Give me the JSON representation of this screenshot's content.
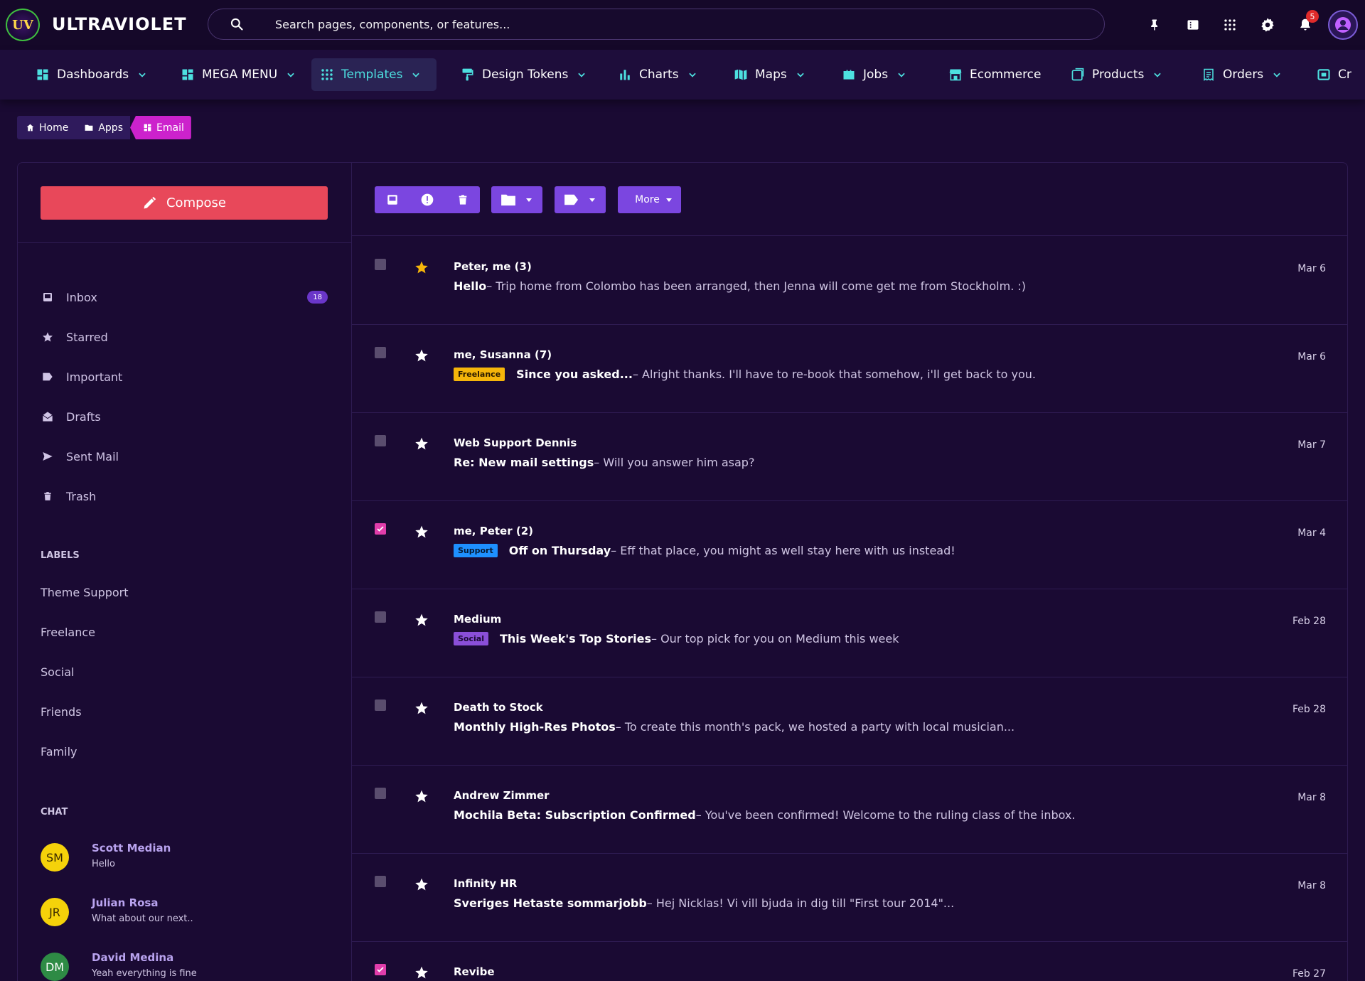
{
  "header": {
    "logo_text": "UV",
    "brand": "ULTRAVIOLET",
    "search_placeholder": "Search pages, components, or features...",
    "notification_count": "5",
    "icons": [
      "search-icon",
      "pin-icon",
      "list-icon",
      "apps-grid-icon",
      "gear-icon",
      "bell-icon",
      "user-icon"
    ]
  },
  "nav": {
    "items": [
      {
        "label": "Dashboards",
        "icon": "dashboard-icon",
        "dropdown": true
      },
      {
        "label": "MEGA MENU",
        "icon": "dashboard-icon",
        "dropdown": true
      },
      {
        "label": "Templates",
        "icon": "grid-dots-icon",
        "dropdown": true,
        "active": true
      },
      {
        "label": "Design Tokens",
        "icon": "paint-roller-icon",
        "dropdown": true
      },
      {
        "label": "Charts",
        "icon": "bar-chart-icon",
        "dropdown": true
      },
      {
        "label": "Maps",
        "icon": "map-icon",
        "dropdown": true
      },
      {
        "label": "Jobs",
        "icon": "briefcase-icon",
        "dropdown": true
      },
      {
        "label": "Ecommerce",
        "icon": "store-icon",
        "dropdown": false
      },
      {
        "label": "Products",
        "icon": "tag-box-icon",
        "dropdown": true
      },
      {
        "label": "Orders",
        "icon": "receipt-icon",
        "dropdown": true
      },
      {
        "label": "Cr",
        "icon": "card-icon",
        "dropdown": false
      }
    ]
  },
  "breadcrumb": [
    {
      "label": "Home",
      "icon": "home-icon"
    },
    {
      "label": "Apps",
      "icon": "folder-icon"
    },
    {
      "label": "Email",
      "icon": "dashboard-icon",
      "current": true
    }
  ],
  "sidebar": {
    "compose_label": "Compose",
    "folders": [
      {
        "label": "Inbox",
        "icon": "inbox-icon",
        "count": "18"
      },
      {
        "label": "Starred",
        "icon": "star-icon"
      },
      {
        "label": "Important",
        "icon": "label-icon"
      },
      {
        "label": "Drafts",
        "icon": "envelope-open-icon"
      },
      {
        "label": "Sent Mail",
        "icon": "send-icon"
      },
      {
        "label": "Trash",
        "icon": "trash-icon"
      }
    ],
    "labels_title": "LABELS",
    "labels": [
      "Theme Support",
      "Freelance",
      "Social",
      "Friends",
      "Family"
    ],
    "chat_title": "CHAT",
    "chats": [
      {
        "initials": "SM",
        "name": "Scott Median",
        "message": "Hello",
        "color": "#f5d20a"
      },
      {
        "initials": "JR",
        "name": "Julian Rosa",
        "message": "What about our next..",
        "color": "#f5d20a"
      },
      {
        "initials": "DM",
        "name": "David Medina",
        "message": "Yeah everything is fine",
        "color": "#2e8b45"
      }
    ]
  },
  "toolbar": {
    "more_label": "More",
    "icons": [
      "inbox-icon",
      "alert-icon",
      "trash-icon",
      "folder-icon",
      "label-icon"
    ]
  },
  "colors": {
    "accent": "#7b46e0",
    "compose": "#e8485a",
    "checked": "#e13dab",
    "star_active": "#f5b50a",
    "tag_freelance": "#f5b50a",
    "tag_support": "#1e90ff",
    "tag_social": "#8a4fd8"
  },
  "emails": [
    {
      "from": "Peter, me (3)",
      "subject": "Hello",
      "snippet": " – Trip home from Colombo has been arranged, then Jenna will come get me from Stockholm. :)",
      "date": "Mar 6",
      "starred": true,
      "checked": false
    },
    {
      "from": "me, Susanna (7)",
      "tag": "Freelance",
      "subject": "Since you asked...",
      "snippet": " – Alright thanks. I'll have to re-book that somehow, i'll get back to you.",
      "date": "Mar 6",
      "starred": false,
      "checked": false
    },
    {
      "from": "Web Support Dennis",
      "subject": "Re: New mail settings",
      "snippet": " – Will you answer him asap?",
      "date": "Mar 7",
      "starred": false,
      "checked": false
    },
    {
      "from": "me, Peter (2)",
      "tag": "Support",
      "subject": "Off on Thursday",
      "snippet": " – Eff that place, you might as well stay here with us instead!",
      "date": "Mar 4",
      "starred": false,
      "checked": true
    },
    {
      "from": "Medium",
      "tag": "Social",
      "subject": "This Week's Top Stories",
      "snippet": " – Our top pick for you on Medium this week",
      "date": "Feb 28",
      "starred": false,
      "checked": false
    },
    {
      "from": "Death to Stock",
      "subject": "Monthly High-Res Photos",
      "snippet": " – To create this month's pack, we hosted a party with local musician...",
      "date": "Feb 28",
      "starred": false,
      "checked": false
    },
    {
      "from": "Andrew Zimmer",
      "subject": "Mochila Beta: Subscription Confirmed",
      "snippet": " – You've been confirmed! Welcome to the ruling class of the inbox.",
      "date": "Mar 8",
      "starred": false,
      "checked": false
    },
    {
      "from": "Infinity HR",
      "subject": "Sveriges Hetaste sommarjobb",
      "snippet": " – Hej Nicklas! Vi vill bjuda in dig till \"First tour 2014\"...",
      "date": "Mar 8",
      "starred": false,
      "checked": false
    },
    {
      "from": "Revibe",
      "subject": "",
      "snippet": "",
      "date": "Feb 27",
      "starred": false,
      "checked": true
    }
  ]
}
